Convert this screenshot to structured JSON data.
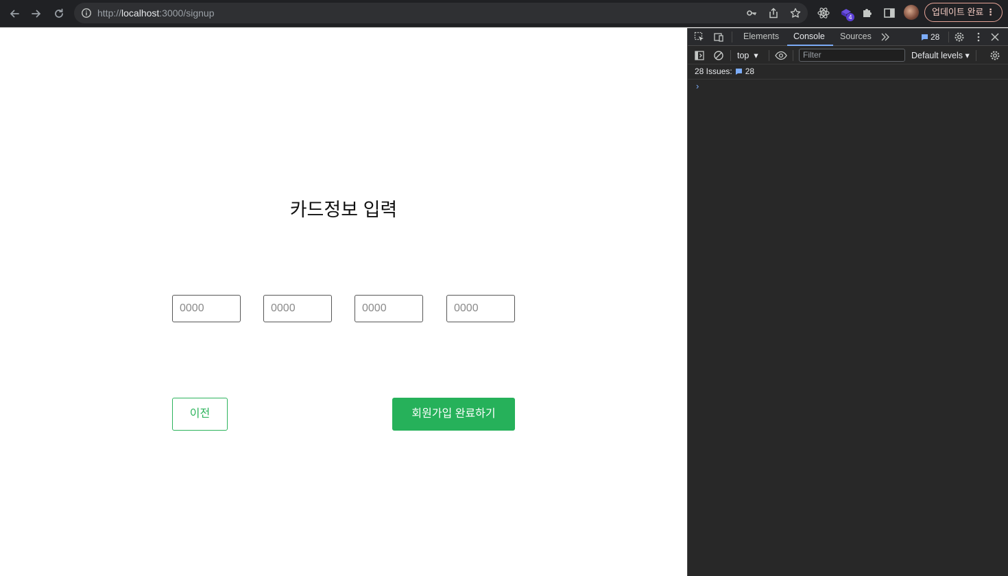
{
  "browser": {
    "url_prefix": "http://",
    "url_host": "localhost",
    "url_rest": ":3000/signup",
    "extension_badge": "4",
    "update_label": "업데이트 완료"
  },
  "page": {
    "title": "카드정보 입력",
    "card_inputs": [
      {
        "placeholder": "0000",
        "value": ""
      },
      {
        "placeholder": "0000",
        "value": ""
      },
      {
        "placeholder": "0000",
        "value": ""
      },
      {
        "placeholder": "0000",
        "value": ""
      }
    ],
    "prev_button": "이전",
    "submit_button": "회원가입 완료하기",
    "accent_color": "#26b15a"
  },
  "devtools": {
    "tabs": [
      "Elements",
      "Console",
      "Sources"
    ],
    "active_tab": "Console",
    "message_count": "28",
    "context": "top",
    "filter_placeholder": "Filter",
    "levels": "Default levels",
    "issues_label": "28 Issues:",
    "issues_count": "28",
    "prompt": "›"
  }
}
